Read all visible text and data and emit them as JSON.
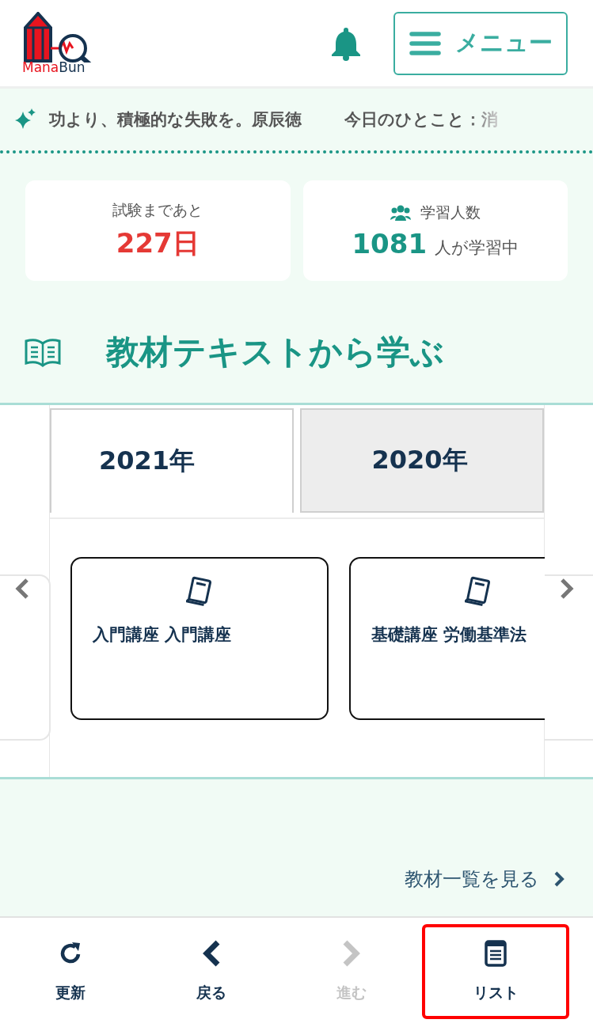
{
  "logo": {
    "parts": [
      "Mana",
      "Bun"
    ]
  },
  "header": {
    "menu_label": "メニュー"
  },
  "ticker": {
    "items": [
      "功より、積極的な失敗を。原辰徳",
      "今日のひとこと：消"
    ]
  },
  "stats": [
    {
      "kind": "countdown",
      "label": "試験まであと",
      "value": "227日"
    },
    {
      "kind": "people",
      "label": "学習人数",
      "value": "1081",
      "suffix": "人が学習中"
    }
  ],
  "section": {
    "title": "教材テキストから学ぶ"
  },
  "tabs": [
    {
      "label": "2021年",
      "selected": true
    },
    {
      "label": "2020年",
      "selected": false
    }
  ],
  "courses": [
    {
      "title": "入門講座 入門講座"
    },
    {
      "title": "基礎講座 労働基準法"
    }
  ],
  "more_link": "教材一覧を見る",
  "bottom_nav": [
    {
      "kind": "refresh",
      "label": "更新",
      "disabled": false,
      "highlighted": false
    },
    {
      "kind": "back",
      "label": "戻る",
      "disabled": false,
      "highlighted": false
    },
    {
      "kind": "forward",
      "label": "進む",
      "disabled": true,
      "highlighted": false
    },
    {
      "kind": "list",
      "label": "リスト",
      "disabled": false,
      "highlighted": true
    }
  ]
}
